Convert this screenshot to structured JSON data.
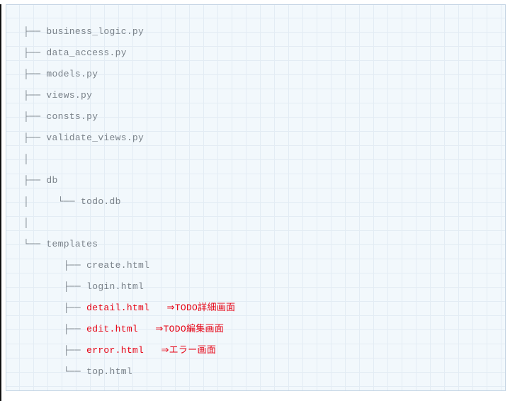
{
  "lines": [
    {
      "prefix": "├── ",
      "name": "business_logic.py",
      "red": false
    },
    {
      "prefix": "├── ",
      "name": "data_access.py",
      "red": false
    },
    {
      "prefix": "├── ",
      "name": "models.py",
      "red": false
    },
    {
      "prefix": "├── ",
      "name": "views.py",
      "red": false
    },
    {
      "prefix": "├── ",
      "name": "consts.py",
      "red": false
    },
    {
      "prefix": "├── ",
      "name": "validate_views.py",
      "red": false
    },
    {
      "prefix": "│",
      "name": "",
      "red": false
    },
    {
      "prefix": "├── ",
      "name": "db",
      "red": false
    },
    {
      "prefix": "│     └── ",
      "name": "todo.db",
      "red": false
    },
    {
      "prefix": "│",
      "name": "",
      "red": false
    },
    {
      "prefix": "└── ",
      "name": "templates",
      "red": false
    },
    {
      "prefix": "       ├── ",
      "name": "create.html",
      "red": false
    },
    {
      "prefix": "       ├── ",
      "name": "login.html",
      "red": false
    },
    {
      "prefix": "       ├── ",
      "name": "detail.html   ⇒TODO詳細画面",
      "red": true
    },
    {
      "prefix": "       ├── ",
      "name": "edit.html   ⇒TODO編集画面",
      "red": true
    },
    {
      "prefix": "       ├── ",
      "name": "error.html   ⇒エラー画面",
      "red": true
    },
    {
      "prefix": "       └── ",
      "name": "top.html",
      "red": false
    }
  ]
}
